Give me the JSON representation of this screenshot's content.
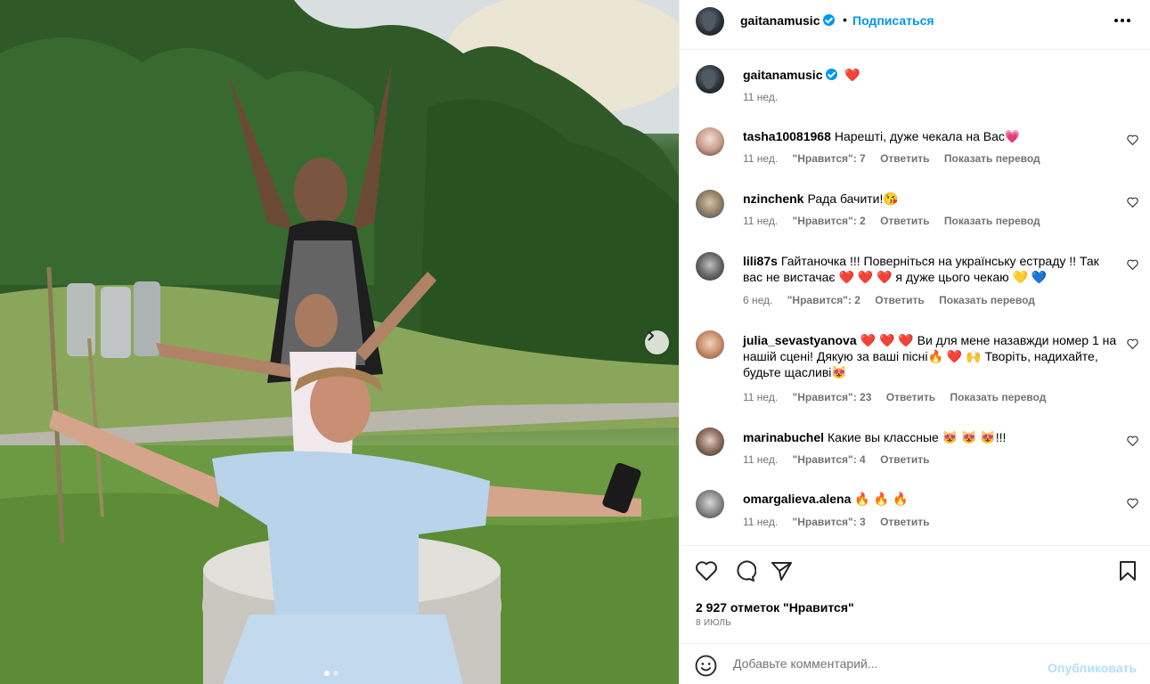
{
  "post": {
    "author": "gaitanamusic",
    "follow_label": "Подписаться",
    "separator": "•",
    "caption": "❤️",
    "caption_time": "11 нед.",
    "carousel": {
      "slides": 2,
      "active_index": 0
    }
  },
  "comments": [
    {
      "user": "tasha10081968",
      "text": "Нарешті, дуже чекала на Вас💗",
      "time": "11 нед.",
      "likes": "\"Нравится\": 7",
      "reply": "Ответить",
      "translate": "Показать перевод"
    },
    {
      "user": "nzinchenk",
      "text": "Рада бачити!😘",
      "time": "11 нед.",
      "likes": "\"Нравится\": 2",
      "reply": "Ответить",
      "translate": "Показать перевод"
    },
    {
      "user": "lili87s",
      "text": "Гайтаночка !!! Поверніться на українську естраду !! Так вас не вистачає ❤️ ❤️ ❤️ я дуже цього чекаю 💛 💙",
      "time": "6 нед.",
      "likes": "\"Нравится\": 2",
      "reply": "Ответить",
      "translate": "Показать перевод"
    },
    {
      "user": "julia_sevastyanova",
      "text": "❤️ ❤️ ❤️ Ви для мене назавжди номер 1 на нашій сцені! Дякую за ваші пісні🔥 ❤️ 🙌 Творіть, надихайте, будьте щасливі😻",
      "time": "11 нед.",
      "likes": "\"Нравится\": 23",
      "reply": "Ответить",
      "translate": "Показать перевод"
    },
    {
      "user": "marinabuchel",
      "text": "Какие вы классные 😻 😻 😻!!!",
      "time": "11 нед.",
      "likes": "\"Нравится\": 4",
      "reply": "Ответить",
      "translate": ""
    },
    {
      "user": "omargalieva.alena",
      "text": "🔥 🔥 🔥",
      "time": "11 нед.",
      "likes": "\"Нравится\": 3",
      "reply": "Ответить",
      "translate": ""
    }
  ],
  "footer": {
    "likes": "2 927 отметок \"Нравится\"",
    "date": "8 ИЮЛЬ",
    "comment_placeholder": "Добавьте комментарий...",
    "publish_label": "Опубликовать"
  },
  "colors": {
    "accent": "#0095f6",
    "publish_disabled": "#b2dffc",
    "meta": "#737373",
    "divider": "#efefef"
  }
}
